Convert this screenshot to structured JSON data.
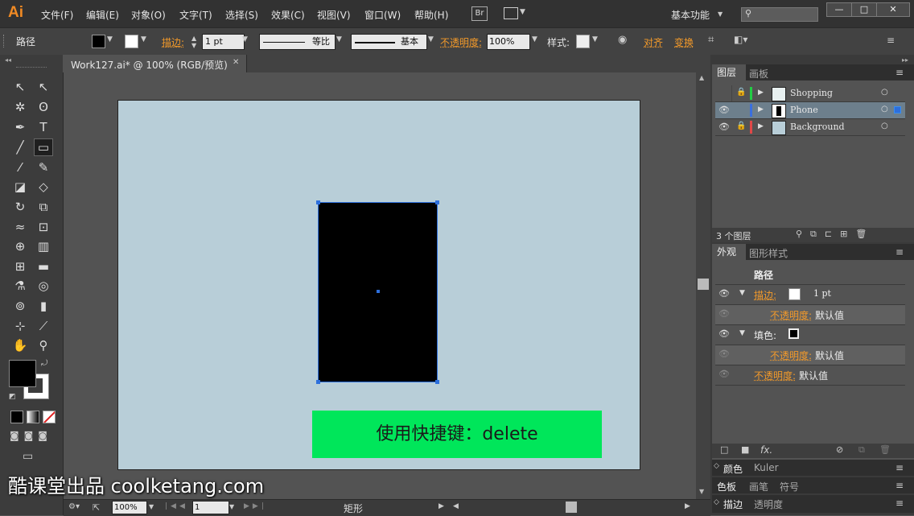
{
  "app": {
    "logo": "Ai",
    "menu": [
      "文件(F)",
      "编辑(E)",
      "对象(O)",
      "文字(T)",
      "选择(S)",
      "效果(C)",
      "视图(V)",
      "窗口(W)",
      "帮助(H)"
    ],
    "bridge_label": "Br",
    "workspace": "基本功能",
    "win_buttons": [
      "—",
      "□",
      "✕"
    ]
  },
  "control_bar": {
    "selection_type": "路径",
    "stroke_label": "描边:",
    "stroke_weight": "1 pt",
    "profile_label": "等比",
    "brush_label": "基本",
    "opacity_label": "不透明度:",
    "opacity_value": "100%",
    "style_label": "样式:",
    "align_label": "对齐",
    "transform_label": "变换"
  },
  "document": {
    "tab_title": "Work127.ai* @ 100% (RGB/预览)",
    "close_glyph": "✕"
  },
  "canvas": {
    "artboard_color": "#b8ced8",
    "shape_fill": "#000000",
    "selection_color": "#2d6fdc",
    "banner_text": "使用快捷键：delete",
    "banner_color": "#00e65a"
  },
  "status_bar": {
    "zoom": "100%",
    "page": "1",
    "tool_name": "矩形"
  },
  "layers_panel": {
    "tabs": [
      "图层",
      "画板"
    ],
    "layers": [
      {
        "name": "Shopping",
        "color": "#22cc44",
        "locked": true,
        "selected": false
      },
      {
        "name": "Phone",
        "color": "#3a6fe0",
        "locked": false,
        "selected": true
      },
      {
        "name": "Background",
        "color": "#e04848",
        "locked": true,
        "selected": false
      }
    ],
    "count_label": "3 个图层"
  },
  "appearance_panel": {
    "tabs": [
      "外观",
      "图形样式"
    ],
    "object_label": "路径",
    "stroke_label": "描边:",
    "stroke_value": "1 pt",
    "opacity_label": "不透明度:",
    "opacity_value": "默认值",
    "fill_label": "填色:",
    "fx_label": "fx."
  },
  "bottom_panels": {
    "row1": [
      "颜色",
      "Kuler"
    ],
    "row2": [
      "色板",
      "画笔",
      "符号"
    ],
    "row3": [
      "描边",
      "透明度"
    ]
  },
  "watermark": "酷课堂出品 coolketang.com"
}
